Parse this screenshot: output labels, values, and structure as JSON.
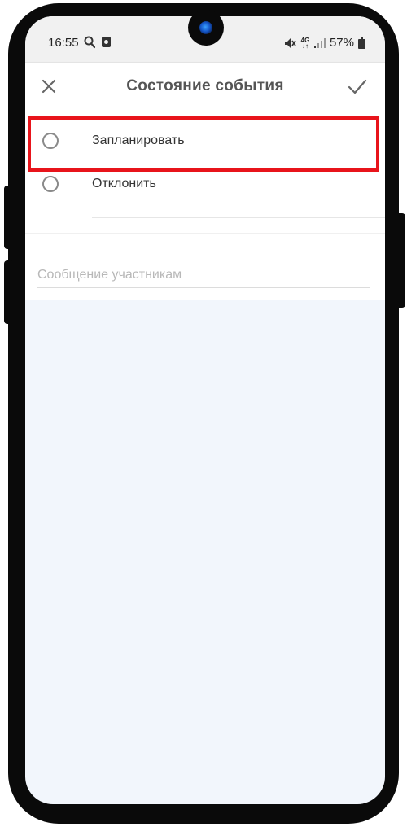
{
  "status_bar": {
    "time": "16:55",
    "network": "4G",
    "battery": "57%",
    "icons": [
      "search-icon",
      "notification-icon",
      "mute-icon",
      "4g-icon",
      "signal-icon",
      "battery-icon"
    ]
  },
  "app_bar": {
    "title": "Состояние события",
    "close_icon": "close-icon",
    "confirm_icon": "check-icon"
  },
  "options": [
    {
      "label": "Запланировать",
      "selected": false,
      "highlighted": true
    },
    {
      "label": "Отклонить",
      "selected": false,
      "highlighted": false
    }
  ],
  "message": {
    "placeholder": "Сообщение участникам",
    "value": ""
  },
  "colors": {
    "highlight": "#e8141b",
    "background": "#f2f6fc"
  }
}
